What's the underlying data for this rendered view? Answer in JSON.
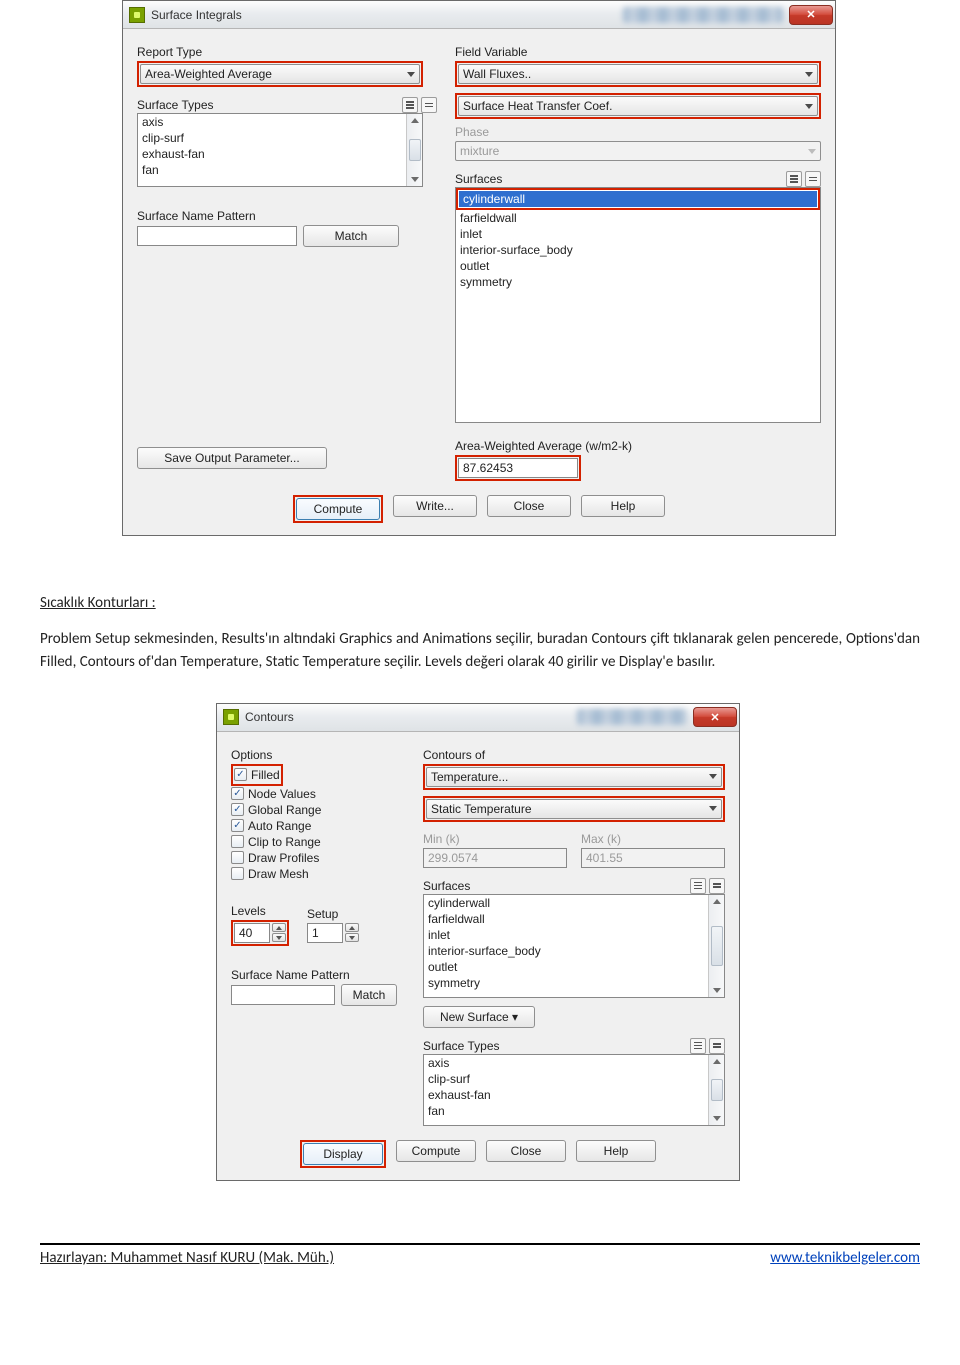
{
  "dialog1": {
    "title": "Surface Integrals",
    "report_type_label": "Report Type",
    "report_type_value": "Area-Weighted Average",
    "surface_types_label": "Surface Types",
    "surface_types_items": [
      "axis",
      "clip-surf",
      "exhaust-fan",
      "fan"
    ],
    "surface_name_pattern_label": "Surface Name Pattern",
    "surface_name_pattern_value": "",
    "match_btn": "Match",
    "save_output_btn": "Save Output Parameter...",
    "field_variable_label": "Field Variable",
    "field_variable_value": "Wall Fluxes..",
    "field_variable_value2": "Surface Heat Transfer Coef.",
    "phase_label": "Phase",
    "phase_value": "mixture",
    "surfaces_label": "Surfaces",
    "surfaces_items": [
      "cylinderwall",
      "farfieldwall",
      "inlet",
      "interior-surface_body",
      "outlet",
      "symmetry"
    ],
    "surfaces_selected_index": 0,
    "result_label": "Area-Weighted Average (w/m2-k)",
    "result_value": "87.62453",
    "buttons": {
      "compute": "Compute",
      "write": "Write...",
      "close": "Close",
      "help": "Help"
    }
  },
  "paragraph": {
    "heading": "Sıcaklık Konturları :",
    "body_line1": "Problem Setup sekmesinden, Results'ın altındaki Graphics and Animations seçilir, buradan Contours çift tıklanarak gelen pencerede, Options'dan Filled, Contours of'dan Temperature, Static Temperature seçilir. Levels değeri olarak 40 girilir ve Display'e basılır."
  },
  "dialog2": {
    "title": "Contours",
    "options_label": "Options",
    "options_items": [
      {
        "label": "Filled",
        "checked": true
      },
      {
        "label": "Node Values",
        "checked": true
      },
      {
        "label": "Global Range",
        "checked": true
      },
      {
        "label": "Auto Range",
        "checked": true
      },
      {
        "label": "Clip to Range",
        "checked": false
      },
      {
        "label": "Draw Profiles",
        "checked": false
      },
      {
        "label": "Draw Mesh",
        "checked": false
      }
    ],
    "levels_label": "Levels",
    "levels_value": "40",
    "setup_label": "Setup",
    "setup_value": "1",
    "surface_name_pattern_label": "Surface Name Pattern",
    "surface_name_pattern_value": "",
    "match_btn": "Match",
    "contours_of_label": "Contours of",
    "contours_of_value": "Temperature...",
    "contours_of_value2": "Static Temperature",
    "min_label": "Min (k)",
    "min_value": "299.0574",
    "max_label": "Max (k)",
    "max_value": "401.55",
    "surfaces_label": "Surfaces",
    "surfaces_items": [
      "cylinderwall",
      "farfieldwall",
      "inlet",
      "interior-surface_body",
      "outlet",
      "symmetry"
    ],
    "new_surface_btn": "New Surface ▾",
    "surface_types_label": "Surface Types",
    "surface_types_items": [
      "axis",
      "clip-surf",
      "exhaust-fan",
      "fan"
    ],
    "buttons": {
      "display": "Display",
      "compute": "Compute",
      "close": "Close",
      "help": "Help"
    }
  },
  "footer": {
    "left": "Hazırlayan: Muhammet Nasıf KURU (Mak. Müh.)",
    "right": "www.teknikbelgeler.com"
  }
}
